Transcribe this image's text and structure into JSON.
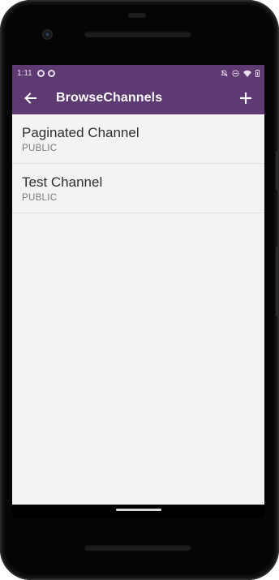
{
  "status_bar": {
    "time": "1:11",
    "left_icons": [
      "app-notification-icon",
      "app-notification-icon"
    ],
    "right_icons": [
      "notifications-off-icon",
      "do-not-disturb-icon",
      "wifi-icon",
      "battery-icon"
    ]
  },
  "app_bar": {
    "title": "BrowseChannels",
    "back_icon": "arrow-back-icon",
    "action_icon": "add-icon",
    "color": "#5e3a73"
  },
  "channels": [
    {
      "name": "Paginated Channel",
      "type": "PUBLIC"
    },
    {
      "name": "Test Channel",
      "type": "PUBLIC"
    }
  ]
}
